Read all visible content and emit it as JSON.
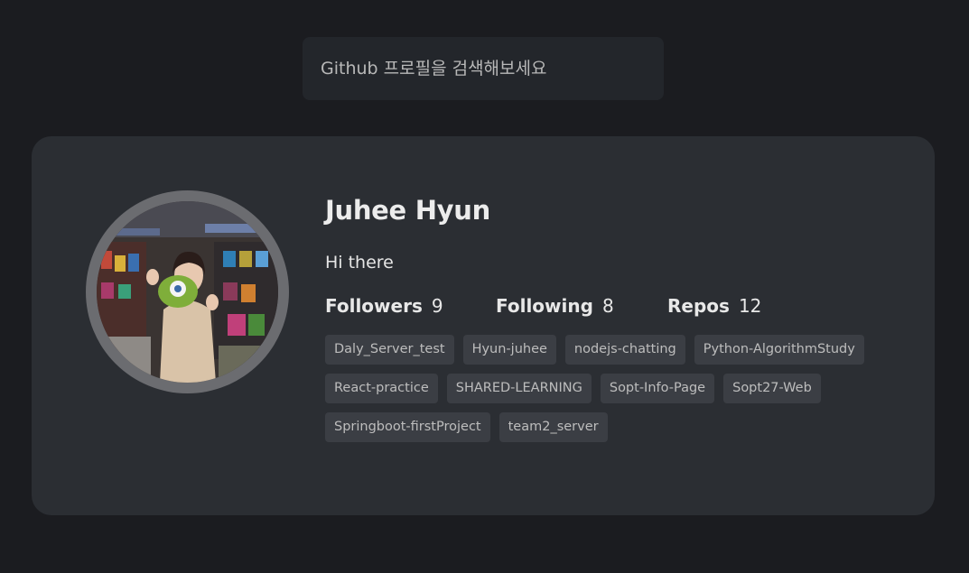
{
  "search": {
    "placeholder": "Github 프로필을 검색해보세요",
    "value": ""
  },
  "profile": {
    "name": "Juhee Hyun",
    "bio": "Hi there",
    "stats": {
      "followers_label": "Followers",
      "followers": "9",
      "following_label": "Following",
      "following": "8",
      "repos_label": "Repos",
      "repos": "12"
    },
    "repos": [
      "Daly_Server_test",
      "Hyun-juhee",
      "nodejs-chatting",
      "Python-AlgorithmStudy",
      "React-practice",
      "SHARED-LEARNING",
      "Sopt-Info-Page",
      "Sopt27-Web",
      "Springboot-firstProject",
      "team2_server"
    ]
  },
  "colors": {
    "background": "#1b1c20",
    "card": "#2b2e33",
    "chip": "#3b3e44",
    "ring": "#6b6c70"
  }
}
